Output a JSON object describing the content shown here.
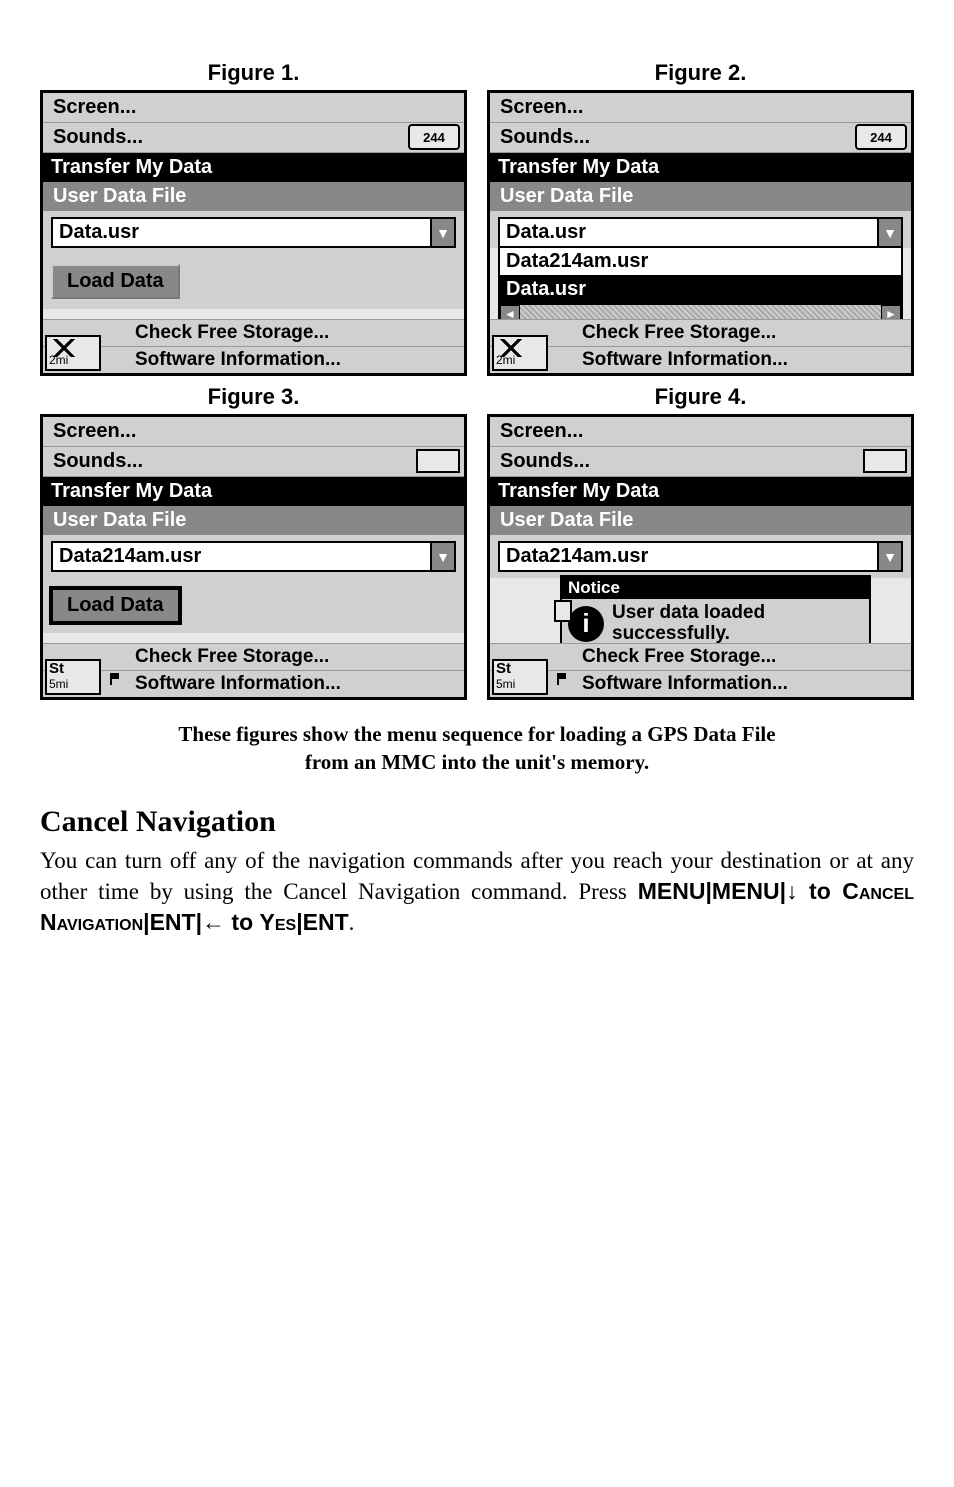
{
  "figures": {
    "f1": {
      "title": "Figure 1."
    },
    "f2": {
      "title": "Figure 2."
    },
    "f3": {
      "title": "Figure 3."
    },
    "f4": {
      "title": "Figure 4."
    }
  },
  "menu": {
    "screen": "Screen...",
    "sounds": "Sounds...",
    "transfer": "Transfer My Data",
    "userfile": "User Data File",
    "check_free": "Check Free Storage...",
    "software_info": "Software Information..."
  },
  "dropdown": {
    "data_usr": "Data.usr",
    "data214": "Data214am.usr"
  },
  "buttons": {
    "load_data": "Load Data"
  },
  "battery": {
    "value": "244"
  },
  "corner": {
    "two_mi": "2mi",
    "five_mi": "5mi",
    "st": "St"
  },
  "notice": {
    "title": "Notice",
    "line1": "User data loaded",
    "line2": "successfully."
  },
  "caption": {
    "line1": "These figures show the menu sequence for loading a GPS Data File",
    "line2": "from an MMC into the unit's memory."
  },
  "section": {
    "heading": "Cancel Navigation",
    "p1a": "You can turn off any of the navigation commands after you reach your destination or at any other time by using the Cancel Navigation command. Press ",
    "menu": "MENU",
    "sep": "|",
    "down_to": "↓ to ",
    "cancel_nav": "Cancel Navigation",
    "ent": "ENT",
    "left_to": "← to ",
    "yes": "Yes",
    "period": "."
  }
}
